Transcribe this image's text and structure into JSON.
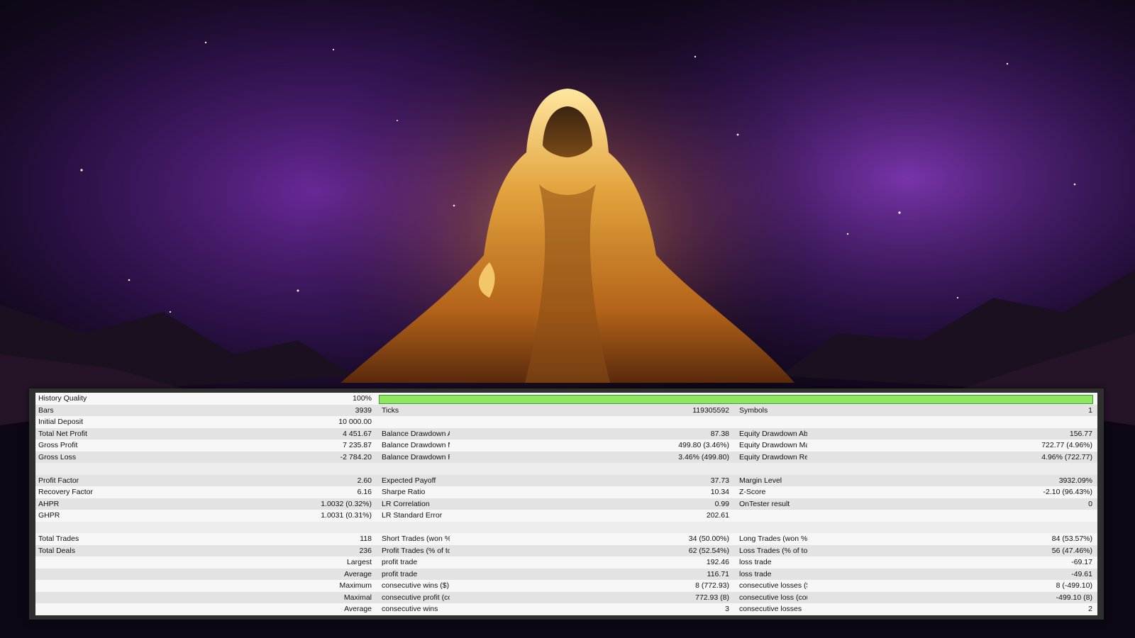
{
  "colors": {
    "progress_fill": "#8fe65f",
    "panel_border": "#2f2f2f",
    "row_light": "#f7f7f7",
    "row_dark": "#e3e3e3"
  },
  "history_quality": {
    "label": "History Quality",
    "value": "100%",
    "progress": 1.0
  },
  "bars": {
    "label": "Bars",
    "value": "3939"
  },
  "ticks": {
    "label": "Ticks",
    "value": "119305592"
  },
  "symbols": {
    "label": "Symbols",
    "value": "1"
  },
  "initial_deposit": {
    "label": "Initial Deposit",
    "value": "10 000.00"
  },
  "total_net_profit": {
    "label": "Total Net Profit",
    "value": "4 451.67"
  },
  "gross_profit": {
    "label": "Gross Profit",
    "value": "7 235.87"
  },
  "gross_loss": {
    "label": "Gross Loss",
    "value": "-2 784.20"
  },
  "balance_dd_abs": {
    "label": "Balance Drawdown Absolute",
    "value": "87.38"
  },
  "balance_dd_max": {
    "label": "Balance Drawdown Maximal",
    "value": "499.80 (3.46%)"
  },
  "balance_dd_rel": {
    "label": "Balance Drawdown Relative",
    "value": "3.46% (499.80)"
  },
  "equity_dd_abs": {
    "label": "Equity Drawdown Absolute",
    "value": "156.77"
  },
  "equity_dd_max": {
    "label": "Equity Drawdown Maximal",
    "value": "722.77 (4.96%)"
  },
  "equity_dd_rel": {
    "label": "Equity Drawdown Relative",
    "value": "4.96% (722.77)"
  },
  "profit_factor": {
    "label": "Profit Factor",
    "value": "2.60"
  },
  "recovery_factor": {
    "label": "Recovery Factor",
    "value": "6.16"
  },
  "ahpr": {
    "label": "AHPR",
    "value": "1.0032 (0.32%)"
  },
  "ghpr": {
    "label": "GHPR",
    "value": "1.0031 (0.31%)"
  },
  "expected_payoff": {
    "label": "Expected Payoff",
    "value": "37.73"
  },
  "sharpe_ratio": {
    "label": "Sharpe Ratio",
    "value": "10.34"
  },
  "lr_correlation": {
    "label": "LR Correlation",
    "value": "0.99"
  },
  "lr_std_error": {
    "label": "LR Standard Error",
    "value": "202.61"
  },
  "margin_level": {
    "label": "Margin Level",
    "value": "3932.09%"
  },
  "z_score": {
    "label": "Z-Score",
    "value": "-2.10 (96.43%)"
  },
  "ontester": {
    "label": "OnTester result",
    "value": "0"
  },
  "total_trades": {
    "label": "Total Trades",
    "value": "118"
  },
  "total_deals": {
    "label": "Total Deals",
    "value": "236"
  },
  "short_trades": {
    "label": "Short Trades (won %)",
    "value": "34 (50.00%)"
  },
  "profit_trades": {
    "label": "Profit Trades (% of total)",
    "value": "62 (52.54%)"
  },
  "long_trades": {
    "label": "Long Trades (won %)",
    "value": "84 (53.57%)"
  },
  "loss_trades": {
    "label": "Loss Trades (% of total)",
    "value": "56 (47.46%)"
  },
  "largest": {
    "label": "Largest",
    "profit_label": "profit trade",
    "profit_value": "192.46",
    "loss_label": "loss trade",
    "loss_value": "-69.17"
  },
  "average": {
    "label": "Average",
    "profit_label": "profit trade",
    "profit_value": "116.71",
    "loss_label": "loss trade",
    "loss_value": "-49.61"
  },
  "maximum": {
    "label": "Maximum",
    "profit_label": "consecutive wins ($)",
    "profit_value": "8 (772.93)",
    "loss_label": "consecutive losses ($)",
    "loss_value": "8 (-499.10)"
  },
  "maximal": {
    "label": "Maximal",
    "profit_label": "consecutive profit (count)",
    "profit_value": "772.93 (8)",
    "loss_label": "consecutive loss (count)",
    "loss_value": "-499.10 (8)"
  },
  "average_consec": {
    "label": "Average",
    "profit_label": "consecutive wins",
    "profit_value": "3",
    "loss_label": "consecutive losses",
    "loss_value": "2"
  }
}
